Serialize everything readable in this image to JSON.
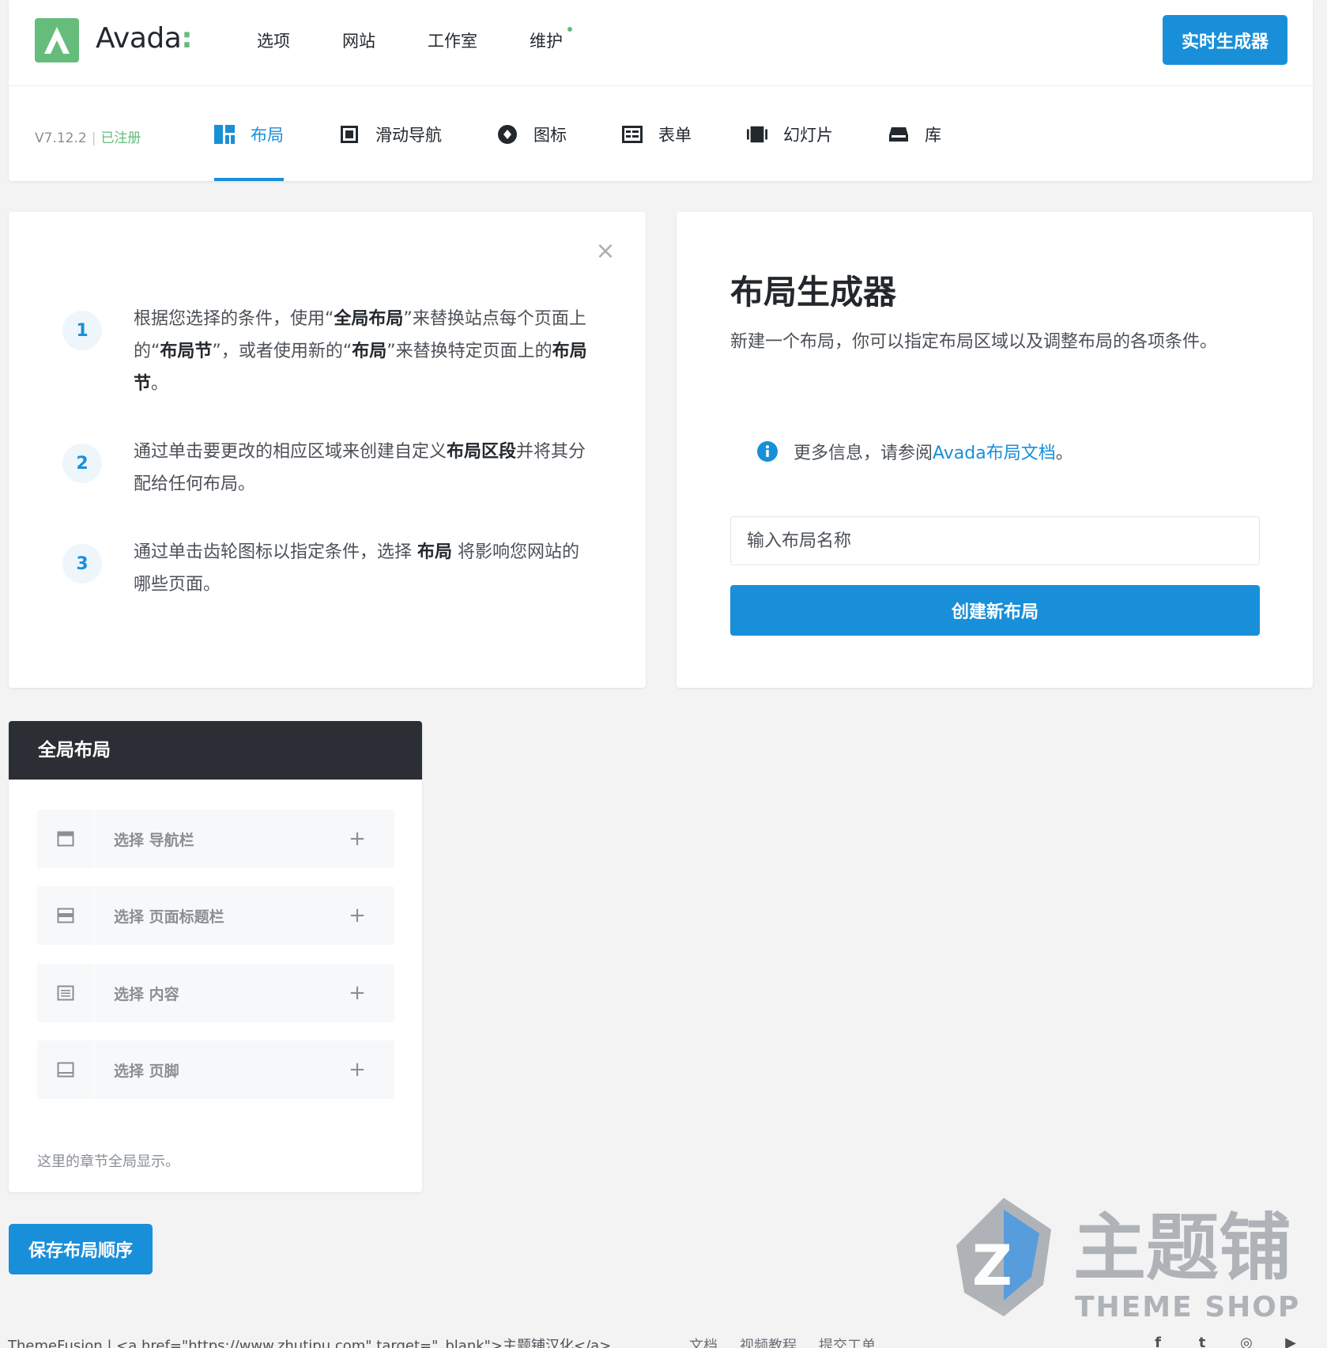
{
  "header": {
    "brand": "Avada",
    "brand_colon": ":",
    "nav": [
      "选项",
      "网站",
      "工作室",
      "维护"
    ],
    "live_builder": "实时生成器"
  },
  "subnav": {
    "version": "V7.12.2",
    "separator": "|",
    "registered": "已注册",
    "tabs": [
      {
        "label": "布局",
        "icon": "layout-icon"
      },
      {
        "label": "滑动导航",
        "icon": "off-canvas-icon"
      },
      {
        "label": "图标",
        "icon": "icons-icon"
      },
      {
        "label": "表单",
        "icon": "forms-icon"
      },
      {
        "label": "幻灯片",
        "icon": "slider-icon"
      },
      {
        "label": "库",
        "icon": "library-icon"
      }
    ]
  },
  "info": {
    "close": "×",
    "steps": [
      {
        "num": "1",
        "parts": [
          "根据您选择的条件，使用“",
          "全局布局",
          "”来替换站点每个页面上的“",
          "布局节",
          "”，或者使用新的“",
          "布局",
          "”来替换特定页面上的",
          "布局节",
          "。"
        ]
      },
      {
        "num": "2",
        "parts": [
          "通过单击要更改的相应区域来创建自定义",
          "布局区段",
          "并将其分配给任何布局。"
        ]
      },
      {
        "num": "3",
        "parts": [
          "通过单击齿轮图标以指定条件，选择 ",
          "布局",
          " 将影响您网站的哪些页面。"
        ]
      }
    ]
  },
  "builder": {
    "title": "布局生成器",
    "description": "新建一个布局，你可以指定布局区域以及调整布局的各项条件。",
    "info_prefix": "更多信息，请参阅 ",
    "info_link": "Avada布局文档",
    "info_suffix": "。",
    "input_placeholder": "输入布局名称",
    "input_value": "",
    "create_button": "创建新布局"
  },
  "global_layout": {
    "title": "全局布局",
    "sections": [
      {
        "label": "选择 导航栏",
        "icon": "header-section-icon"
      },
      {
        "label": "选择 页面标题栏",
        "icon": "page-title-bar-icon"
      },
      {
        "label": "选择 内容",
        "icon": "content-icon"
      },
      {
        "label": "选择 页脚",
        "icon": "footer-section-icon"
      }
    ],
    "plus": "+",
    "note": "这里的章节全局显示。",
    "save_button": "保存布局顺序"
  },
  "watermark": {
    "cn": "主题铺",
    "en": "THEME SHOP"
  },
  "footer": {
    "credit": "ThemeFusion | <a href=\"https://www.zhutipu.com\" target=\"_blank\">主题铺汉化</a>",
    "links": [
      "文档",
      "视频教程",
      "提交工单"
    ],
    "social": [
      "facebook-icon",
      "twitter-icon",
      "instagram-icon",
      "youtube-icon"
    ]
  },
  "colors": {
    "accent": "#198fd9",
    "brand_green": "#65bc7b",
    "dark_header": "#2b2f35"
  }
}
